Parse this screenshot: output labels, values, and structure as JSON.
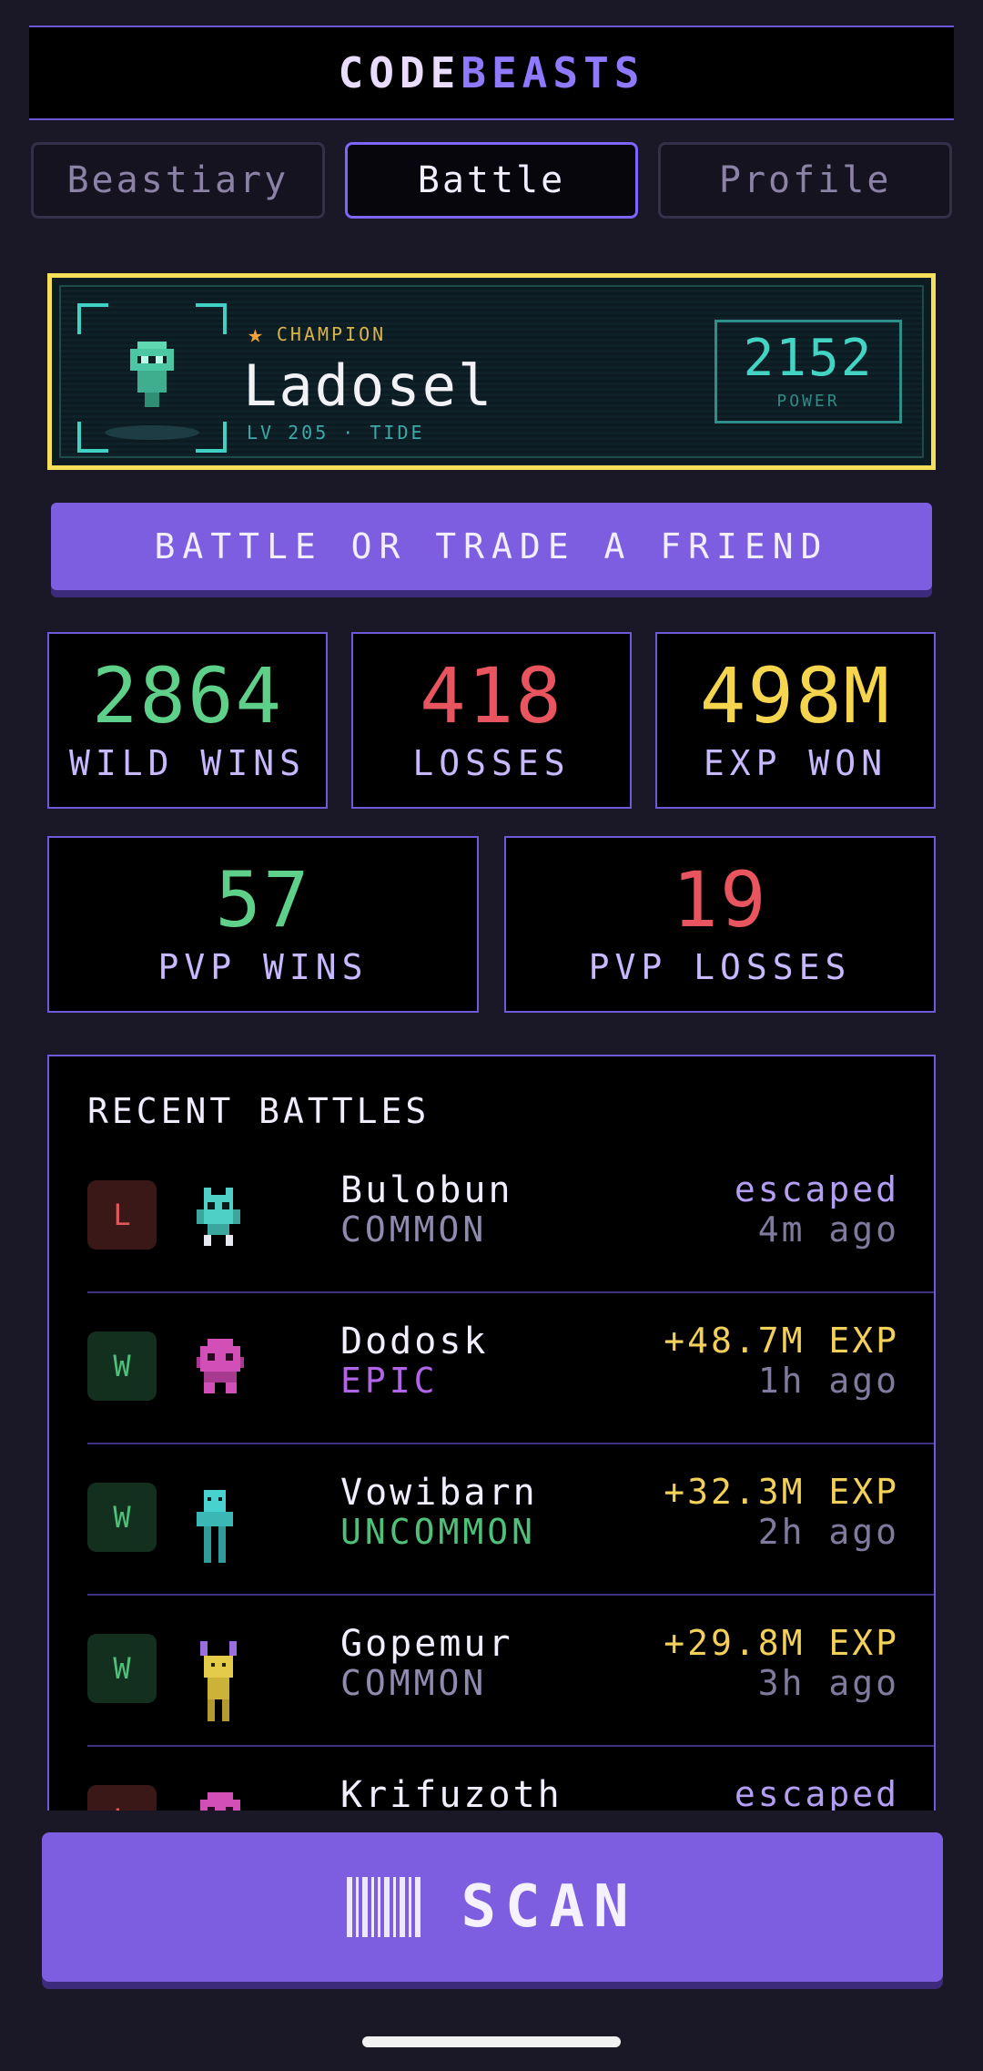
{
  "app": {
    "logo_part1": "CODE",
    "logo_part2": "BEASTS"
  },
  "tabs": [
    {
      "label": "Beastiary",
      "active": false
    },
    {
      "label": "Battle",
      "active": true
    },
    {
      "label": "Profile",
      "active": false
    }
  ],
  "champion": {
    "tag": "CHAMPION",
    "name": "Ladosel",
    "level_line": "LV 205 · TIDE",
    "power_value": "2152",
    "power_label": "POWER"
  },
  "friend_button": {
    "label": "BATTLE OR TRADE A FRIEND"
  },
  "stats": {
    "wild_wins": {
      "value": "2864",
      "label": "WILD WINS",
      "color": "#5fd08a"
    },
    "losses": {
      "value": "418",
      "label": "LOSSES",
      "color": "#e8555e"
    },
    "exp_won": {
      "value": "498M",
      "label": "EXP WON",
      "color": "#f6d54e"
    },
    "pvp_wins": {
      "value": "57",
      "label": "PVP WINS",
      "color": "#5fd08a"
    },
    "pvp_losses": {
      "value": "19",
      "label": "PVP LOSSES",
      "color": "#e8555e"
    }
  },
  "recent": {
    "title": "RECENT BATTLES",
    "rows": [
      {
        "result": "L",
        "name": "Bulobun",
        "rarity": "COMMON",
        "outcome": "escaped",
        "time": "4m ago"
      },
      {
        "result": "W",
        "name": "Dodosk",
        "rarity": "EPIC",
        "outcome": "+48.7M EXP",
        "time": "1h ago"
      },
      {
        "result": "W",
        "name": "Vowibarn",
        "rarity": "UNCOMMON",
        "outcome": "+32.3M EXP",
        "time": "2h ago"
      },
      {
        "result": "W",
        "name": "Gopemur",
        "rarity": "COMMON",
        "outcome": "+29.8M EXP",
        "time": "3h ago"
      },
      {
        "result": "L",
        "name": "Krifuzoth",
        "rarity": "",
        "outcome": "escaped",
        "time": ""
      }
    ]
  },
  "scan": {
    "label": "SCAN"
  },
  "colors": {
    "accent": "#7e5ee0",
    "champion_border": "#f6e05a",
    "teal": "#43d4c4"
  }
}
